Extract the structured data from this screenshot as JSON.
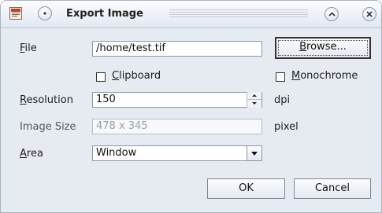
{
  "window": {
    "title": "Export Image"
  },
  "icons": {
    "app": "image-document-icon",
    "menu": "window-menu-icon",
    "shade": "shade-up-icon",
    "close": "close-icon"
  },
  "file": {
    "label_mnemonic": "F",
    "label_rest": "ile",
    "value": "/home/test.tif"
  },
  "browse_button": {
    "mnemonic": "B",
    "rest": "rowse..."
  },
  "clipboard": {
    "mnemonic": "C",
    "rest": "lipboard",
    "checked": false
  },
  "monochrome": {
    "mnemonic": "M",
    "rest": "onochrome",
    "checked": false
  },
  "resolution": {
    "label_mnemonic": "R",
    "label_rest": "esolution",
    "value": "150",
    "unit": "dpi"
  },
  "image_size": {
    "label": "Image Size",
    "value": "478 x 345",
    "unit": "pixel"
  },
  "area": {
    "label_mnemonic": "A",
    "label_rest": "rea",
    "selected": "Window"
  },
  "buttons": {
    "ok": "OK",
    "cancel": "Cancel"
  }
}
